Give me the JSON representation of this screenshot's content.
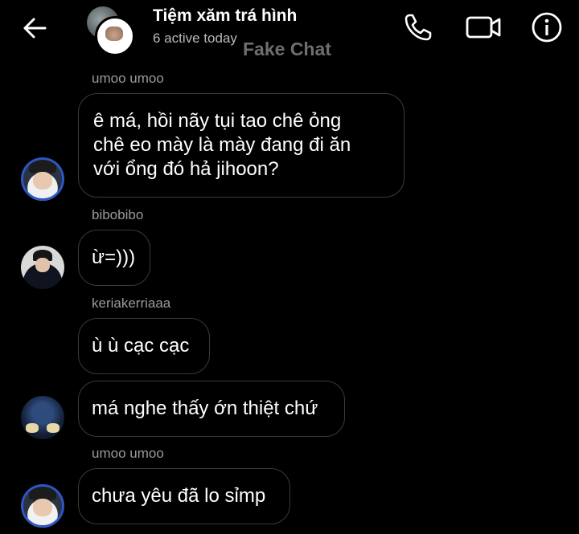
{
  "header": {
    "title": "Tiệm xăm trá hình",
    "status": "6 active today",
    "watermark": "Fake Chat",
    "icons": [
      "back-arrow-icon",
      "phone-icon",
      "video-camera-icon",
      "info-icon"
    ]
  },
  "messages": [
    {
      "sender": "umoo umoo",
      "lines": [
        "ê má, hồi nãy tụi tao chê ỏng",
        "chê eo mày là mày đang đi ăn",
        "với ổng đó hả jihoon?"
      ],
      "avatar": "glasses-boy-avatar"
    },
    {
      "sender": "bibobibo",
      "text": "ừ=)))",
      "avatar": "jersey-boy-avatar"
    },
    {
      "sender": "keriakerriaaa",
      "text": "ù ù cạc cạc",
      "avatar": ""
    },
    {
      "sender": "",
      "text": "má nghe thấy ớn thiệt chứ",
      "avatar": "blue-photo-avatar"
    },
    {
      "sender": "umoo umoo",
      "text": "chưa yêu đã lo sỉmp",
      "avatar": "glasses-boy-avatar"
    }
  ],
  "colors": {
    "background": "#000000",
    "bubble_border": "#3a3a3a",
    "sender_text": "#9a9a9a",
    "status_text": "#b8b8b8"
  }
}
